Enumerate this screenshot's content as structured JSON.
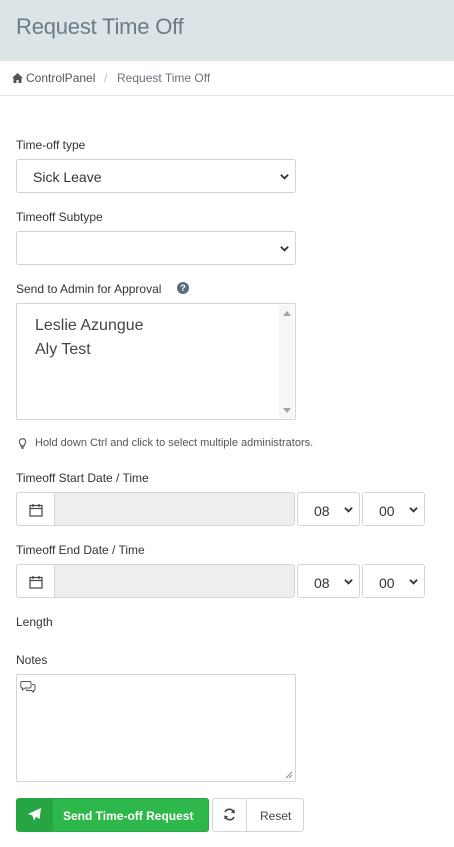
{
  "header": {
    "title": "Request Time Off"
  },
  "breadcrumb": {
    "home": "ControlPanel",
    "separator": "/",
    "current": "Request Time Off"
  },
  "form": {
    "timeoff_type": {
      "label": "Time-off type",
      "value": "Sick Leave"
    },
    "timeoff_subtype": {
      "label": "Timeoff Subtype",
      "value": ""
    },
    "admins": {
      "label": "Send to Admin for Approval",
      "options": [
        "Leslie Azungue",
        "Aly Test"
      ]
    },
    "hint": "Hold down Ctrl and click to select multiple administrators.",
    "start": {
      "label": "Timeoff Start Date / Time",
      "hour": "08",
      "minute": "00"
    },
    "end": {
      "label": "Timeoff End Date / Time",
      "hour": "08",
      "minute": "00"
    },
    "length": {
      "label": "Length"
    },
    "notes": {
      "label": "Notes"
    }
  },
  "buttons": {
    "send": "Send Time-off Request",
    "reset": "Reset"
  },
  "colors": {
    "header_bg": "#dce4e8",
    "primary_green": "#2eb84b",
    "input_disabled": "#eeeeee"
  }
}
